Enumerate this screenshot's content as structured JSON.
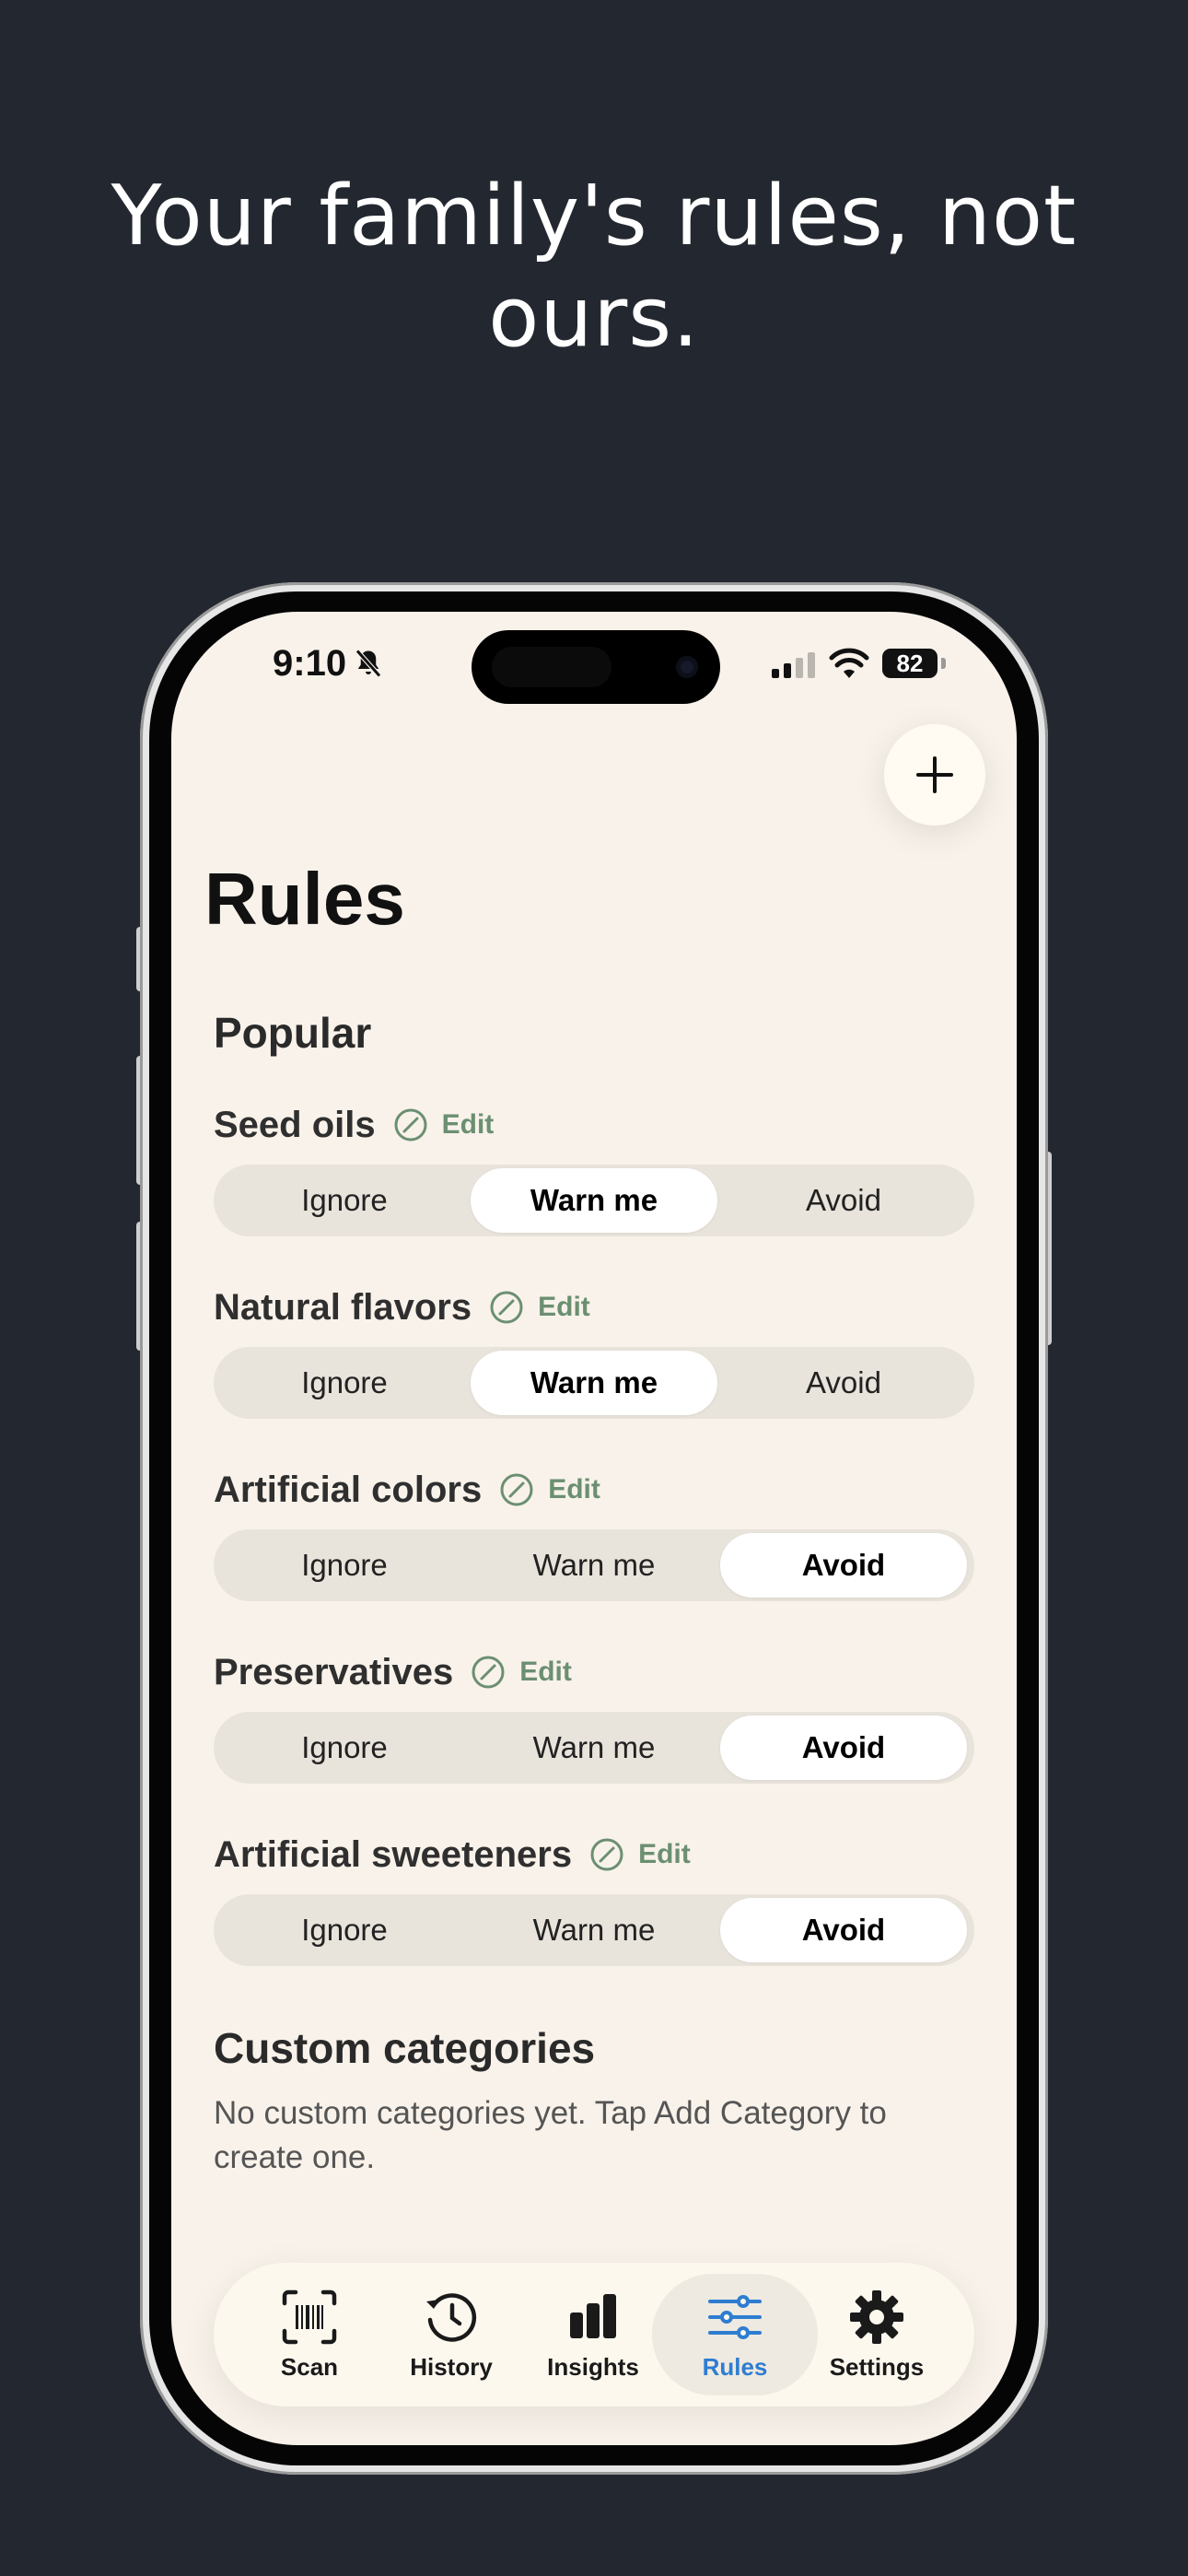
{
  "headline": {
    "line1": "Your family's rules, not",
    "line2": "ours."
  },
  "status_bar": {
    "time": "9:10",
    "battery": "82"
  },
  "page": {
    "title": "Rules",
    "popular_section_title": "Popular",
    "custom_section_title": "Custom categories",
    "custom_empty_text": "No custom categories yet. Tap Add Category to create one."
  },
  "edit_label": "Edit",
  "options": [
    "Ignore",
    "Warn me",
    "Avoid"
  ],
  "rules": [
    {
      "name": "Seed oils",
      "selected": "Warn me"
    },
    {
      "name": "Natural flavors",
      "selected": "Warn me"
    },
    {
      "name": "Artificial colors",
      "selected": "Avoid"
    },
    {
      "name": "Preservatives",
      "selected": "Avoid"
    },
    {
      "name": "Artificial sweeteners",
      "selected": "Avoid"
    }
  ],
  "tabs": [
    {
      "label": "Scan",
      "icon": "barcode-scan-icon",
      "selected": false
    },
    {
      "label": "History",
      "icon": "history-clock-icon",
      "selected": false
    },
    {
      "label": "Insights",
      "icon": "bar-chart-icon",
      "selected": false
    },
    {
      "label": "Rules",
      "icon": "sliders-icon",
      "selected": true
    },
    {
      "label": "Settings",
      "icon": "gear-icon",
      "selected": false
    }
  ],
  "colors": {
    "background": "#232830",
    "screen": "#f8f2ea",
    "accent_blue": "#2e7dd1",
    "edit_green": "#6b8f71"
  }
}
